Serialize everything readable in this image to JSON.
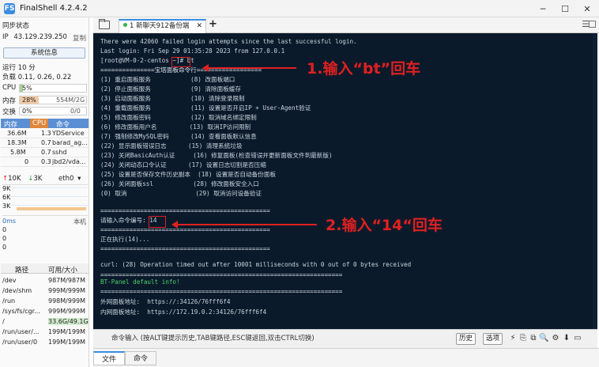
{
  "window": {
    "title": "FinalShell 4.2.4.2",
    "logo": "FS",
    "minimize_icon": "─",
    "maximize_icon": "☐",
    "close_icon": "✕"
  },
  "sidebar": {
    "sync_status": "同步状态",
    "ip_label": "IP",
    "ip_value": "43.129.239.250",
    "copy_label": "复制",
    "sysinfo_button": "系统信息",
    "uptime": "运行 10 分",
    "load": "负载 0.11, 0.26, 0.22",
    "cpu": {
      "label": "CPU",
      "value": "5%",
      "percent": 5
    },
    "mem": {
      "label": "内存",
      "percent_text": "28%",
      "percent": 28,
      "detail": "554M/2G"
    },
    "swap": {
      "label": "交换",
      "percent_text": "0%",
      "percent": 0,
      "detail": "0/0"
    },
    "process_headers": [
      "内存",
      "CPU",
      "命令"
    ],
    "processes": [
      {
        "mem": "36.6M",
        "cpu": "1.3",
        "cmd": "YDService"
      },
      {
        "mem": "18.3M",
        "cpu": "0.7",
        "cmd": "barad_ag..."
      },
      {
        "mem": "5.8M",
        "cpu": "0.7",
        "cmd": "sshd"
      },
      {
        "mem": "0",
        "cpu": "0.3",
        "cmd": "jbd2/vda..."
      }
    ],
    "net": {
      "up": "10K",
      "down": "3K",
      "iface": "eth0",
      "up_arrow": "↑",
      "down_arrow": "↓",
      "ticks": [
        "9K",
        "6K",
        "3K"
      ]
    },
    "ping": {
      "value": "0ms",
      "host": "本机",
      "ticks": [
        "0",
        "0",
        "0"
      ]
    },
    "disk_headers": [
      "路径",
      "可用/大小"
    ],
    "disks": [
      {
        "path": "/dev",
        "size": "987M/987M"
      },
      {
        "path": "/dev/shm",
        "size": "999M/999M"
      },
      {
        "path": "/run",
        "size": "998M/999M"
      },
      {
        "path": "/sys/fs/cgr...",
        "size": "999M/999M"
      },
      {
        "path": "/",
        "size": "33.6G/49.1G"
      },
      {
        "path": "/run/user/...",
        "size": "199M/199M"
      },
      {
        "path": "/run/user/0",
        "size": "199M/199M"
      }
    ]
  },
  "tabs": {
    "active": "1 新聊天912备份端",
    "close": "✕",
    "add": "+"
  },
  "terminal": {
    "lines": [
      "There were 42060 failed login attempts since the last successful login.",
      "Last login: Fri Sep 29 01:35:28 2023 from 127.0.0.1",
      "[root@VM-0-2-centos ~]# bt",
      "===============宝塔面板命令行==================",
      "(1) 重启面板服务           (8) 改面板端口",
      "(2) 停止面板服务           (9) 清除面板缓存",
      "(3) 启动面板服务           (10) 清除登录限制",
      "(4) 重载面板服务           (11) 设置是否开启IP + User-Agent验证",
      "(5) 修改面板密码           (12) 取消域名绑定限制",
      "(6) 修改面板用户名         (13) 取消IP访问限制",
      "(7) 强制修改MySQL密码      (14) 查看面板默认信息",
      "(22) 显示面板错误日志      (15) 清理系统垃圾",
      "(23) 关闭BasicAuth认证     (16) 修复面板(检查错误并更新面板文件到最新版)",
      "(24) 关闭动态口令认证      (17) 设置日志切割是否压缩",
      "(25) 设置是否保存文件历史副本  (18) 设置是否自动备份面板",
      "(26) 关闭面板ssl           (28) 修改面板安全入口",
      "(0) 取消                   (29) 取消访问设备验证",
      "===============================================",
      "请输入命令编号: 14",
      "===============================================",
      "正在执行(14)...",
      "===============================================",
      "curl: (28) Operation timed out after 10001 milliseconds with 0 out of 0 bytes received",
      "===================================================================",
      "BT-Panel default info!",
      "===================================================================",
      "外网面板地址:  https://:34126/76fff6f4",
      "内网面板地址:  https://172.19.0.2:34126/76fff6f4"
    ]
  },
  "annotations": {
    "step1": "1.输入“bt”回车",
    "step2": "2.输入“14“回车"
  },
  "cmdbar": {
    "placeholder": "命令输入 (按ALT键提示历史,TAB键路径,ESC键返回,双击CTRL切换)",
    "history": "历史",
    "options": "选项",
    "icons": [
      "⚡",
      "⎘",
      "⧉",
      "🔍",
      "⚙",
      "⬇",
      "▭"
    ]
  },
  "bottom_tabs": [
    "文件",
    "命令"
  ]
}
